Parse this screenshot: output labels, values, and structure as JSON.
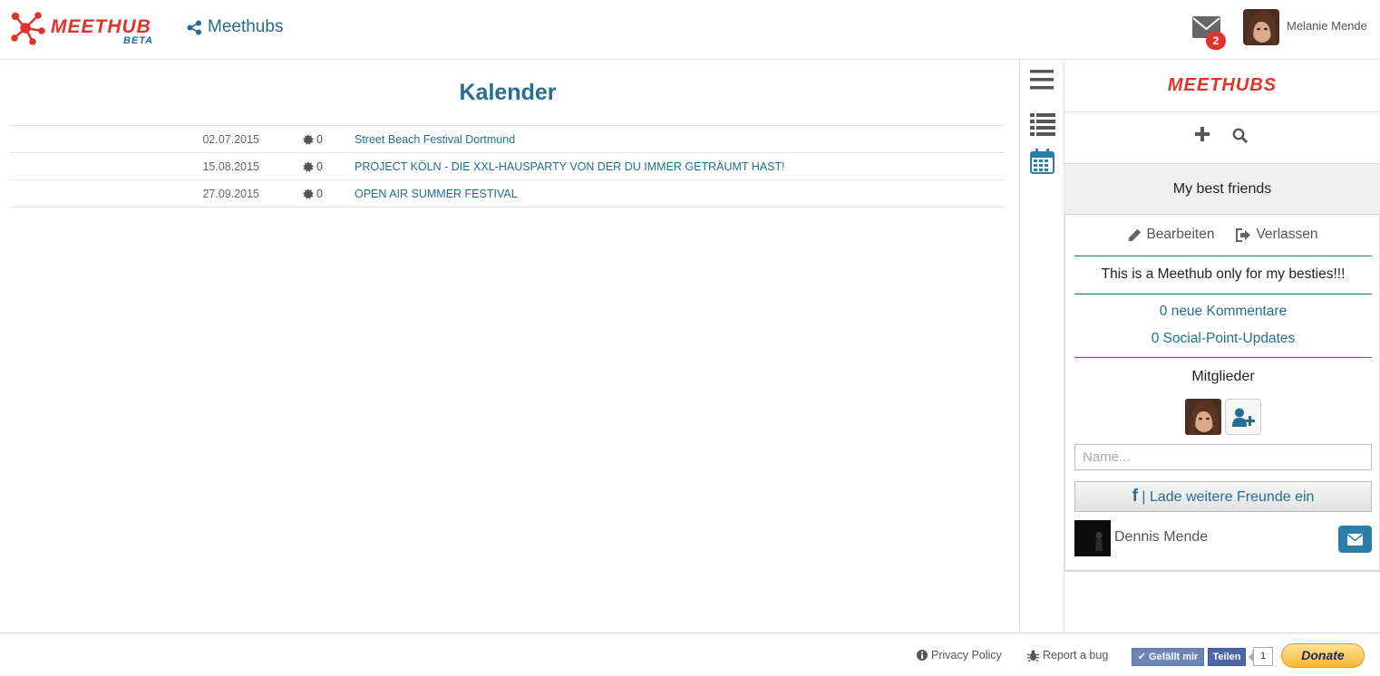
{
  "header": {
    "logo_text": "MEETHUB",
    "logo_beta": "BETA",
    "nav_label": "Meethubs",
    "mail_badge": "2",
    "user_name": "Melanie Mende"
  },
  "calendar": {
    "title": "Kalender",
    "events": [
      {
        "date": "02.07.2015",
        "count": "0",
        "name": "Street Beach Festival Dortmund"
      },
      {
        "date": "15.08.2015",
        "count": "0",
        "name": "PROJECT KÖLN - DIE XXL-HAUSPARTY VON DER DU IMMER GETRÄUMT HAST!"
      },
      {
        "date": "27.09.2015",
        "count": "0",
        "name": "OPEN AIR SUMMER FESTIVAL"
      }
    ]
  },
  "panel": {
    "logo_text": "MEETHUBS",
    "group_name": "My best friends",
    "edit_label": "Bearbeiten",
    "leave_label": "Verlassen",
    "description": "This is a Meethub only for my besties!!!",
    "new_comments": "0 neue Kommentare",
    "social_updates": "0 Social-Point-Updates",
    "members_label": "Mitglieder",
    "name_placeholder": "Name...",
    "invite_label": "| Lade weitere Freunde ein",
    "friend_name": "Dennis Mende"
  },
  "footer": {
    "privacy": "Privacy Policy",
    "report": "Report a bug",
    "fb_like": "Gefällt mir",
    "fb_share": "Teilen",
    "fb_count": "1",
    "donate": "Donate"
  },
  "colors": {
    "brand_red": "#e2332a",
    "accent_blue": "#236f92",
    "badge_red": "#e2332a"
  }
}
